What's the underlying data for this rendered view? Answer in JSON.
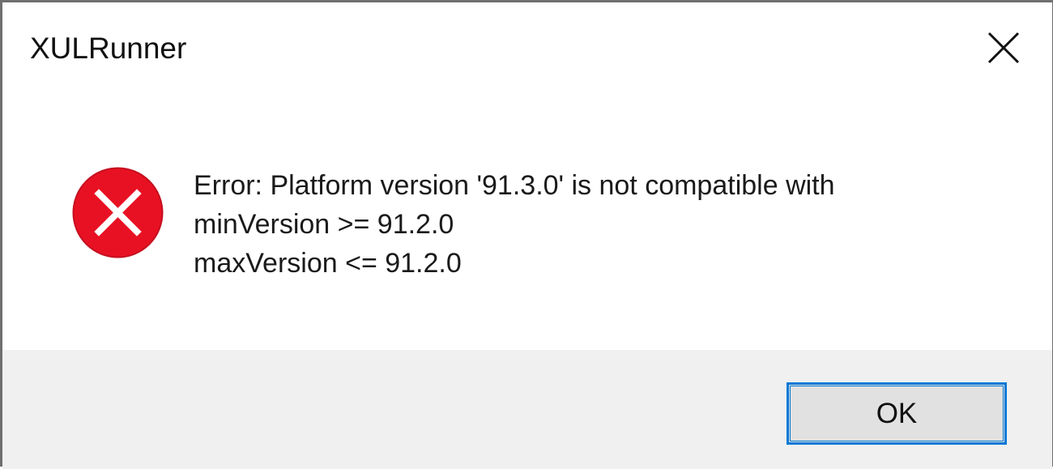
{
  "window": {
    "title": "XULRunner",
    "close_icon": "close-icon"
  },
  "message": {
    "icon": "error-icon",
    "icon_color": "#e81123",
    "lines": [
      "Error: Platform version '91.3.0' is not compatible with",
      "minVersion >= 91.2.0",
      "maxVersion <= 91.2.0"
    ]
  },
  "footer": {
    "ok_label": "OK",
    "accent": "#0078d7"
  }
}
